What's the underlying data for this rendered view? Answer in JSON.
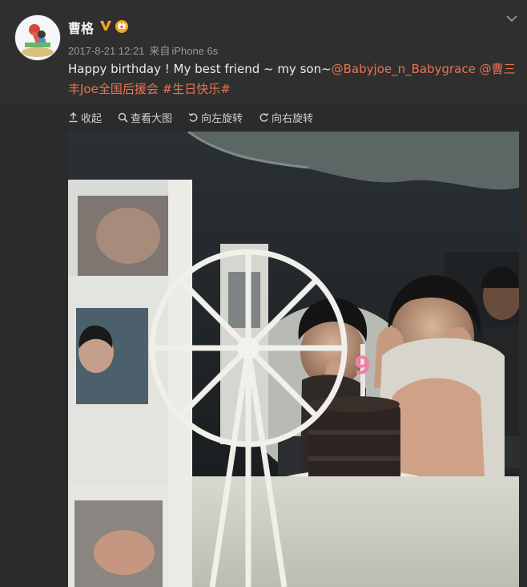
{
  "post": {
    "username": "曹格",
    "date": "2017-8-21 12:21",
    "source_prefix": "来自",
    "source_device": "iPhone 6s",
    "text_intro": "Happy birthday ! My best friend ~ my son~",
    "mention_1": "@Babyjoe_n_Babygrace",
    "mention_2": "@曹三丰Joe全国后援会",
    "hashtag": "#生日快乐#"
  },
  "toolbar": {
    "collapse_label": "收起",
    "view_large_label": "查看大图",
    "rotate_left_label": "向左旋转",
    "rotate_right_label": "向右旋转"
  },
  "icons": {
    "verified": "verified-v-icon",
    "fan_badge": "fan-badge-icon",
    "more": "chevron-down-icon",
    "collapse": "collapse-arrow-icon",
    "zoom": "search-icon",
    "rotate_left": "rotate-left-icon",
    "rotate_right": "rotate-right-icon"
  },
  "colors": {
    "link": "#eb7350",
    "verified": "#f5a623",
    "background": "#2b2b2b"
  }
}
